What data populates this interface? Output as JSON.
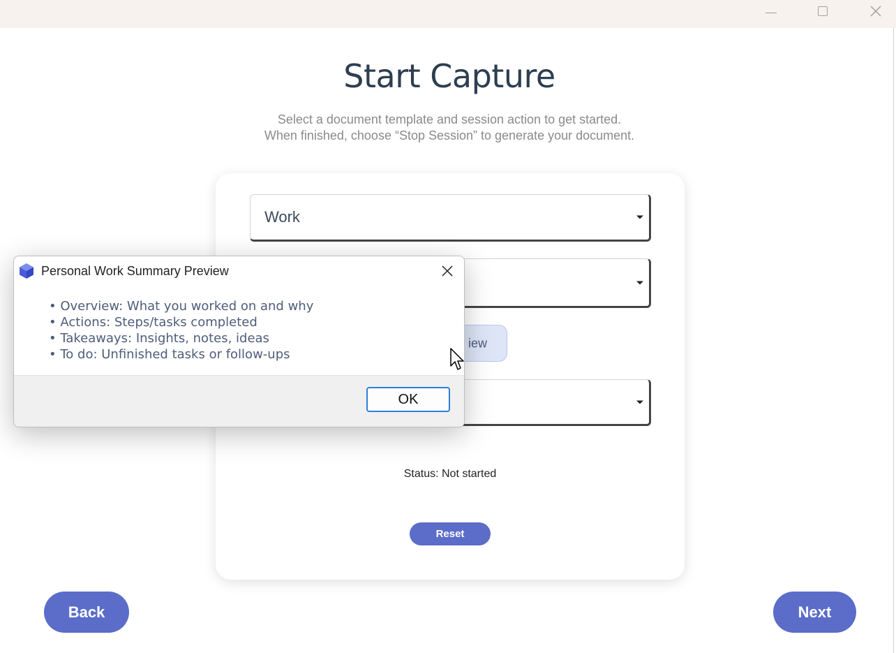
{
  "window": {
    "controls": {
      "minimize": "minimize-icon",
      "maximize": "maximize-icon",
      "close": "close-icon"
    }
  },
  "header": {
    "title": "Start Capture",
    "subtitle_line1": "Select a document template and session action to get started.",
    "subtitle_line2": "When finished, choose “Stop Session” to generate your document."
  },
  "form": {
    "template_select_value": "Work",
    "preview_button_visible_text": "iew",
    "status_text": "Status: Not started",
    "reset_label": "Reset"
  },
  "navigation": {
    "back_label": "Back",
    "next_label": "Next"
  },
  "dialog": {
    "title": "Personal Work Summary Preview",
    "bullets": [
      "Overview: What you worked on and why",
      "Actions: Steps/tasks completed",
      "Takeaways: Insights, notes, ideas",
      "To do: Unfinished tasks or follow-ups"
    ],
    "ok_label": "OK"
  },
  "colors": {
    "accent": "#5b6dc8",
    "title_text": "#2d3e50",
    "preview_button_bg": "#dde5f7",
    "ok_border": "#2f7ed8"
  }
}
